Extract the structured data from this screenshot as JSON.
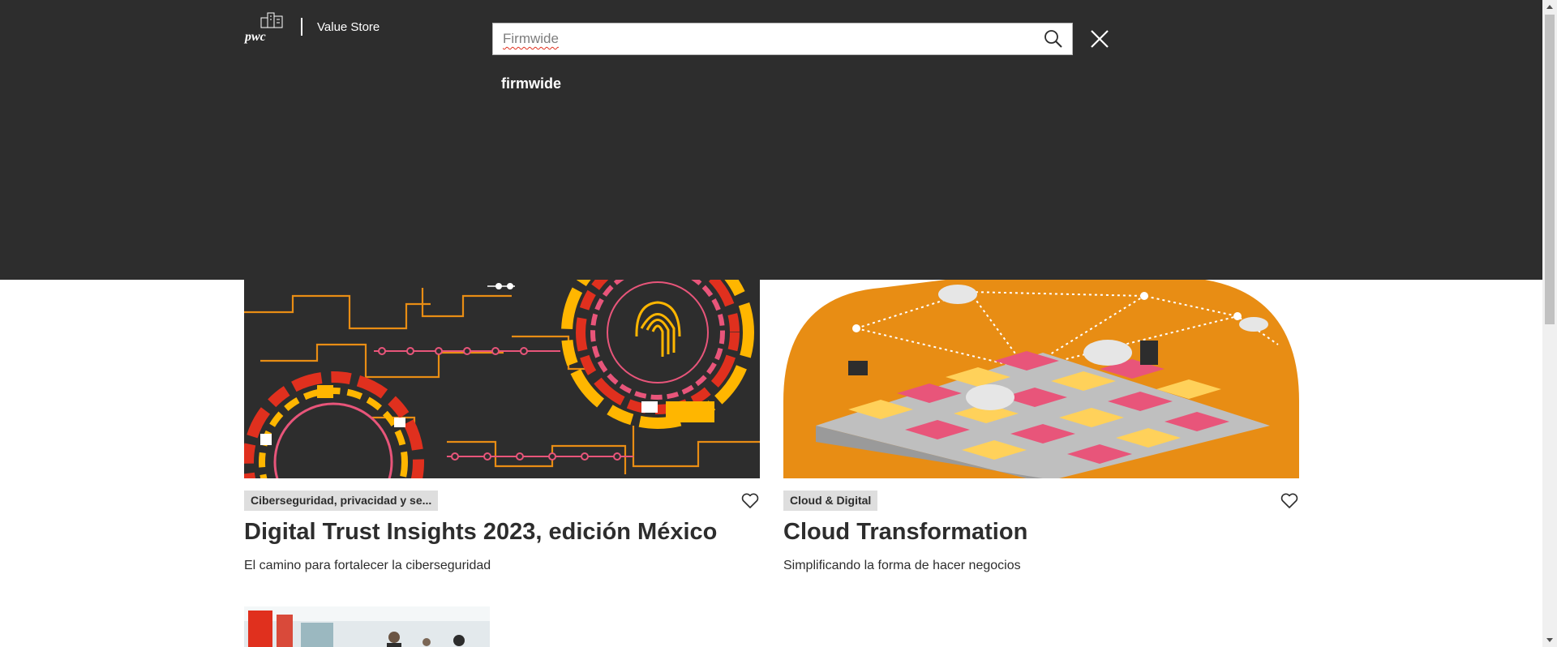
{
  "header": {
    "logo_icon": "pwc-logo-icon",
    "store_name": "Value Store"
  },
  "search": {
    "value": "Firmwide",
    "search_icon": "search-icon",
    "close_icon": "close-icon",
    "suggestions": [
      "firmwide"
    ]
  },
  "cards": [
    {
      "tag": "Ciberseguridad, privacidad y se...",
      "title": "Digital Trust Insights 2023, edición México",
      "subtitle": "El camino para fortalecer la ciberseguridad",
      "favorite_icon": "heart-icon"
    },
    {
      "tag": "Cloud & Digital",
      "title": "Cloud Transformation",
      "subtitle": "Simplificando la forma de hacer negocios",
      "favorite_icon": "heart-icon"
    }
  ],
  "colors": {
    "overlay_bg": "#2d2d2d",
    "accent_orange": "#e88d14",
    "accent_pink": "#e8557a",
    "accent_yellow": "#ffb600",
    "tag_bg": "#dedede"
  }
}
